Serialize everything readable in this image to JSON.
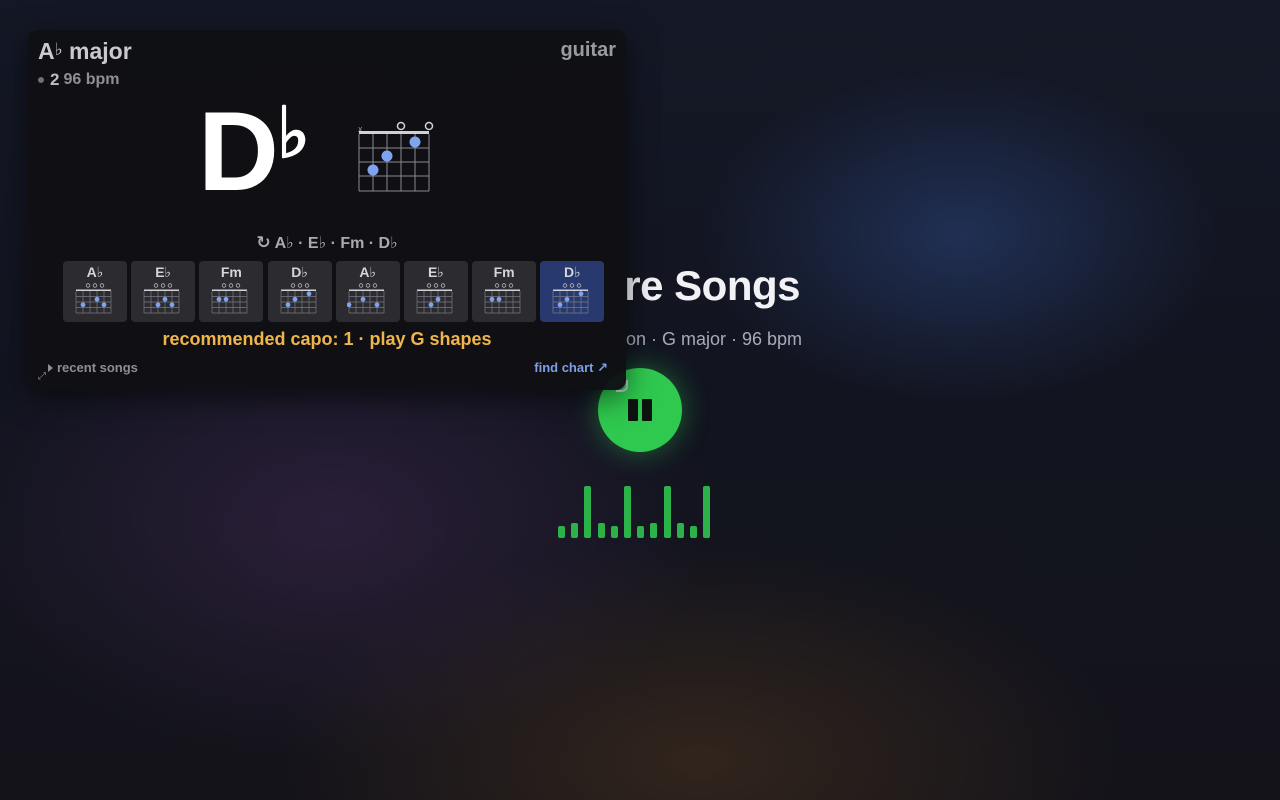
{
  "player": {
    "title_visible": "re Songs",
    "meta_visible": "on · G major · 96 bpm",
    "eq_levels": [
      0.23,
      0.28,
      1.0,
      0.28,
      0.23,
      1.0,
      0.23,
      0.28,
      1.0,
      0.28,
      0.23,
      1.0
    ],
    "accent_color": "#2fc94f",
    "play_icon": "pause-icon"
  },
  "panel": {
    "key_root": "A",
    "key_accidental": "♭",
    "key_quality": "major",
    "beat": "2",
    "bpm_label": "96 bpm",
    "instrument": "guitar",
    "current_chord_root": "D",
    "current_chord_accidental": "♭",
    "progression": "A♭ · E♭ · Fm · D♭",
    "chords": [
      {
        "name": "A♭"
      },
      {
        "name": "E♭"
      },
      {
        "name": "Fm"
      },
      {
        "name": "D♭"
      },
      {
        "name": "A♭"
      },
      {
        "name": "E♭"
      },
      {
        "name": "Fm"
      },
      {
        "name": "D♭",
        "active": true
      }
    ],
    "capo_text": "recommended capo: 1 · play G shapes",
    "recent_songs_label": "recent songs",
    "find_chart_label": "find chart ↗",
    "capo_color": "#f0b54a",
    "link_color": "#7f9fe8",
    "dot_color": "#7ea4f0"
  }
}
